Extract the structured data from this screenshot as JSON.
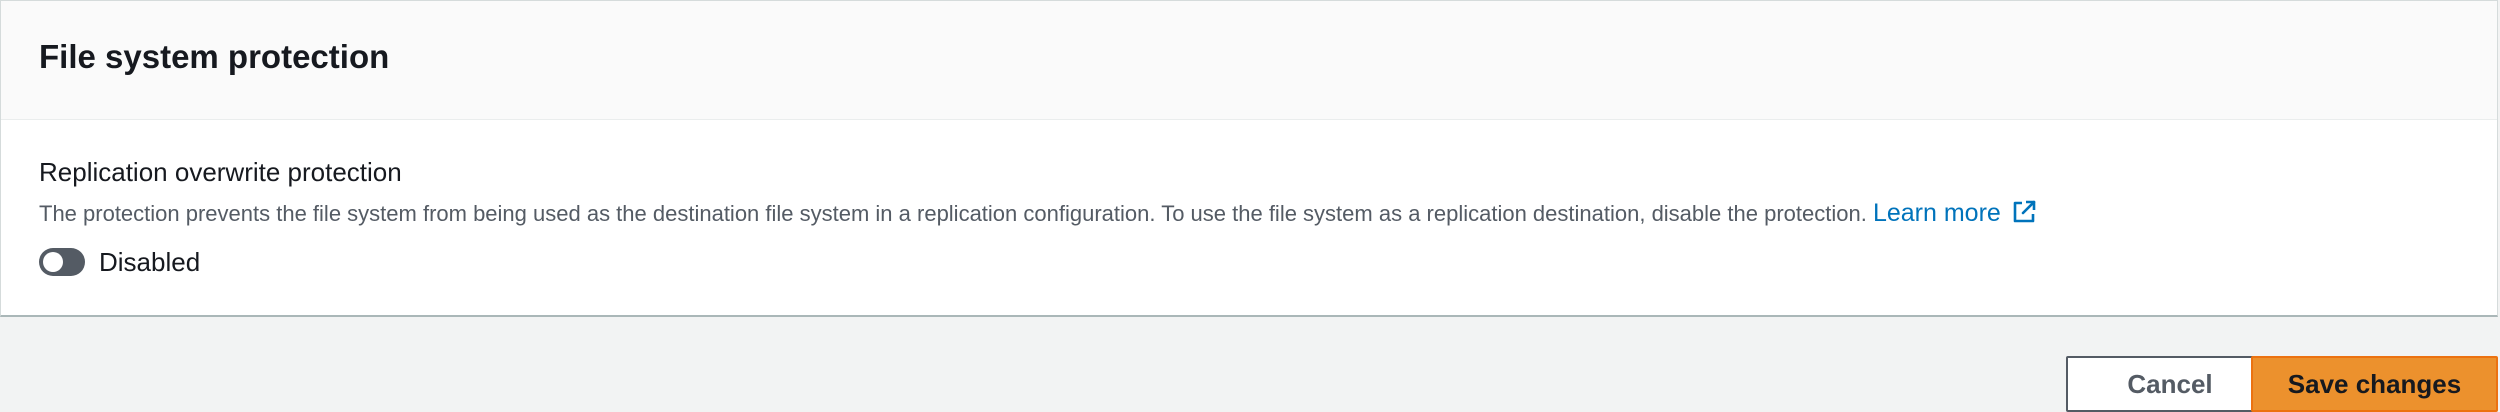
{
  "panel": {
    "title": "File system protection"
  },
  "field": {
    "label": "Replication overwrite protection",
    "description": "The protection prevents the file system from being used as the destination file system in a replication configuration. To use the file system as a replication destination, disable the protection.",
    "learn_more": "Learn more"
  },
  "toggle": {
    "checked": false,
    "label": "Disabled"
  },
  "actions": {
    "cancel_label": "Cancel",
    "save_label": "Save changes"
  },
  "colors": {
    "link": "#0073bb",
    "primary_button": "#ec912d",
    "toggle_off": "#545b64"
  },
  "icons": {
    "learn_more_icon": "external-link-icon"
  }
}
